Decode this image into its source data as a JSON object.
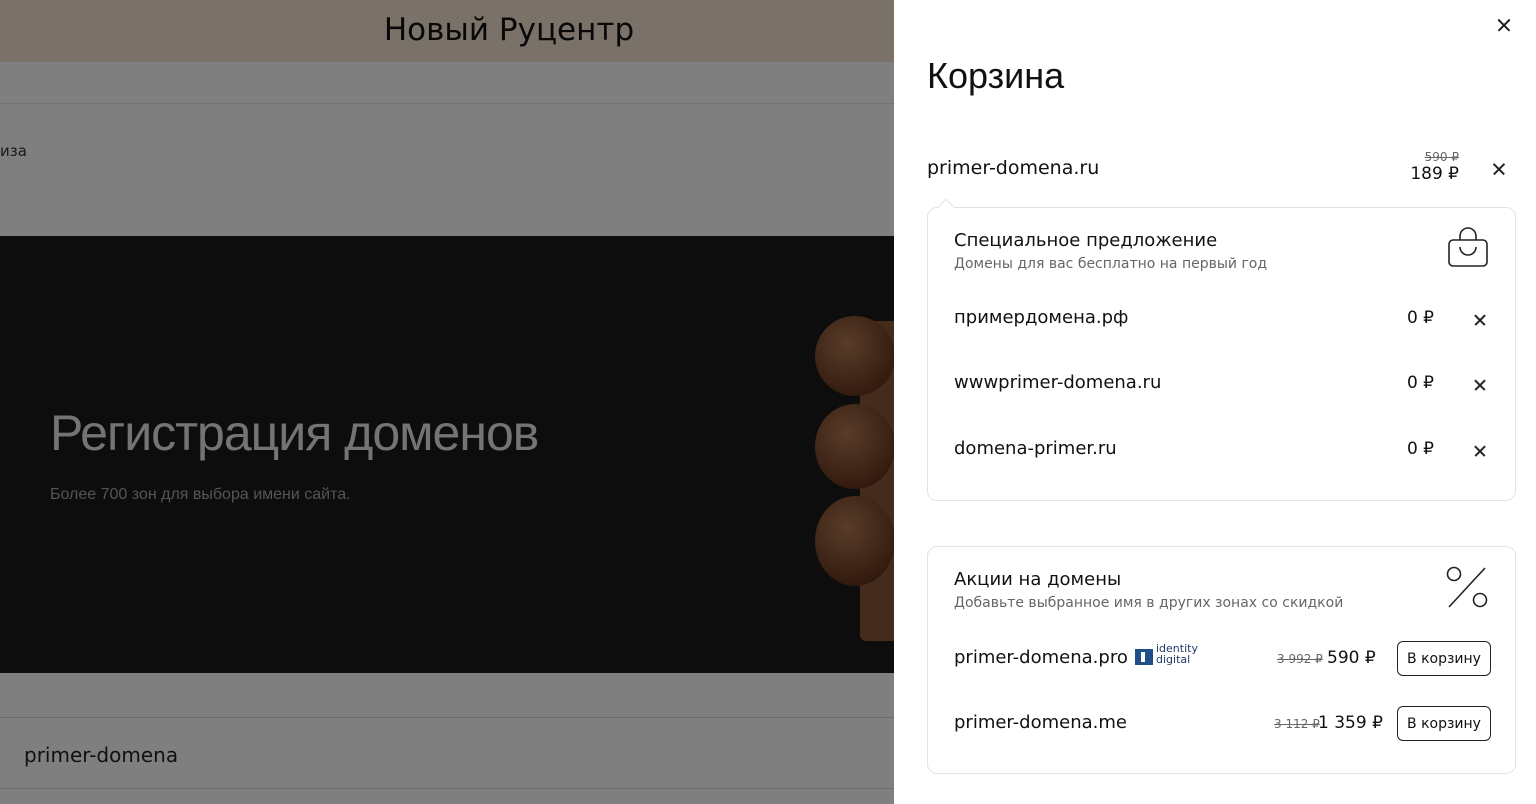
{
  "background": {
    "banner_title": "Новый Руцентр",
    "breadcrumb": "иза",
    "hero_title": "Регистрация доменов",
    "hero_subtitle": "Более 700 зон для выбора имени сайта.",
    "search_value": "primer-domena"
  },
  "cart": {
    "title": "Корзина",
    "main_item": {
      "domain": "primer-domena.ru",
      "old_price": "590 ₽",
      "price": "189 ₽"
    },
    "special_offer": {
      "title": "Специальное предложение",
      "subtitle": "Домены для вас бесплатно на первый год",
      "icon": "shopping-bag-icon",
      "items": [
        {
          "domain": "примердомена.рф",
          "price": "0 ₽"
        },
        {
          "domain": "wwwprimer-domena.ru",
          "price": "0 ₽"
        },
        {
          "domain": "domena-primer.ru",
          "price": "0 ₽"
        }
      ]
    },
    "promotions": {
      "title": "Акции на домены",
      "subtitle": "Добавьте выбранное имя в других зонах со скидкой",
      "icon": "percent-icon",
      "items": [
        {
          "domain": "primer-domena.pro",
          "registry_logo": "identity digital",
          "logo_line1": "identity",
          "logo_line2": "digital",
          "old_price": "3 992 ₽",
          "price": "590 ₽",
          "button": "В корзину"
        },
        {
          "domain": "primer-domena.me",
          "old_price": "3 112 ₽",
          "price": "1 359 ₽",
          "button": "В корзину"
        }
      ]
    }
  }
}
